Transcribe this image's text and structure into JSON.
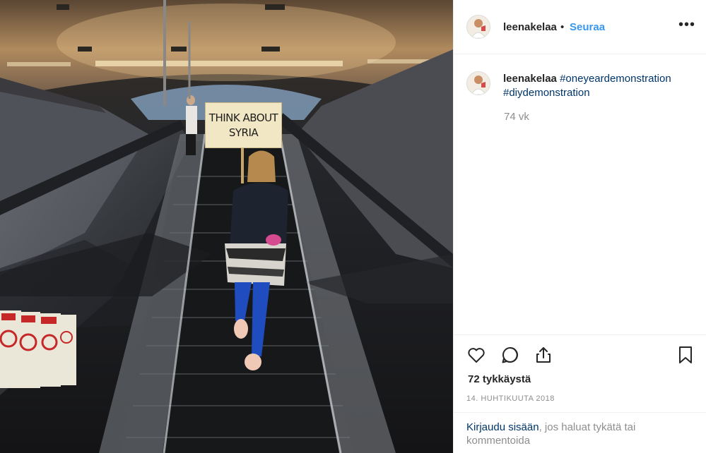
{
  "post": {
    "sign_text_line1": "THINK ABOUT",
    "sign_text_line2": "SYRIA"
  },
  "header": {
    "username": "leenakelaa",
    "separator": "•",
    "follow_label": "Seuraa",
    "more_label": "•••"
  },
  "caption": {
    "username": "leenakelaa",
    "hashtag_1": "#oneyeardemonstration",
    "hashtag_2": "#diydemonstration",
    "age": "74 vk"
  },
  "actions": {
    "likes": "72 tykkäystä",
    "date": "14. HUHTIKUUTA 2018",
    "icons": [
      "heart-icon",
      "comment-icon",
      "share-icon",
      "bookmark-icon"
    ]
  },
  "footer": {
    "login_link": "Kirjaudu sisään",
    "login_rest": ", jos haluat tykätä tai kommentoida"
  },
  "colors": {
    "link_blue": "#3897f0",
    "hashtag": "#003569",
    "muted": "#8e8e8e",
    "divider": "#efefef"
  }
}
